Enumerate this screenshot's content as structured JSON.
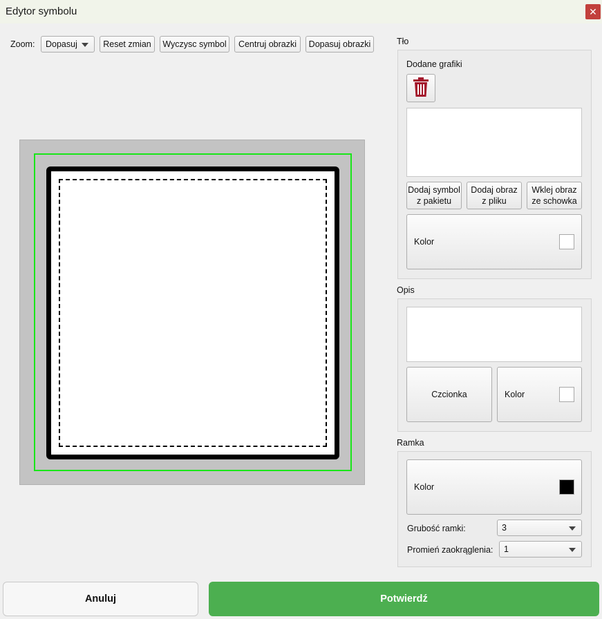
{
  "window": {
    "title": "Edytor symbolu",
    "close_glyph": "✕"
  },
  "toolbar": {
    "zoom_label": "Zoom:",
    "zoom_value": "Dopasuj",
    "reset_label": "Reset zmian",
    "clear_label": "Wyczysc symbol",
    "center_label": "Centruj obrazki",
    "fit_label": "Dopasuj obrazki"
  },
  "background": {
    "section_title": "Tło",
    "added_graphics_label": "Dodane grafiki",
    "delete_icon": "trash-icon",
    "add_from_package": [
      "Dodaj symbol",
      "z pakietu"
    ],
    "add_from_file": [
      "Dodaj obraz",
      "z pliku"
    ],
    "paste_from_clipboard": [
      "Wklej obraz",
      "ze schowka"
    ],
    "color_label": "Kolor",
    "color_value": "#ffffff"
  },
  "description": {
    "section_title": "Opis",
    "font_label": "Czcionka",
    "color_label": "Kolor",
    "color_value": "#ffffff"
  },
  "frame": {
    "section_title": "Ramka",
    "color_label": "Kolor",
    "color_value": "#000000",
    "thickness_label": "Grubość ramki:",
    "thickness_value": "3",
    "radius_label": "Promień zaokrąglenia:",
    "radius_value": "1"
  },
  "footer": {
    "cancel_label": "Anuluj",
    "confirm_label": "Potwierdź"
  },
  "colors": {
    "accent_confirm": "#4caf50",
    "close_button": "#c2403c",
    "selection_outline": "#19e619",
    "trash_icon": "#a3172b"
  }
}
